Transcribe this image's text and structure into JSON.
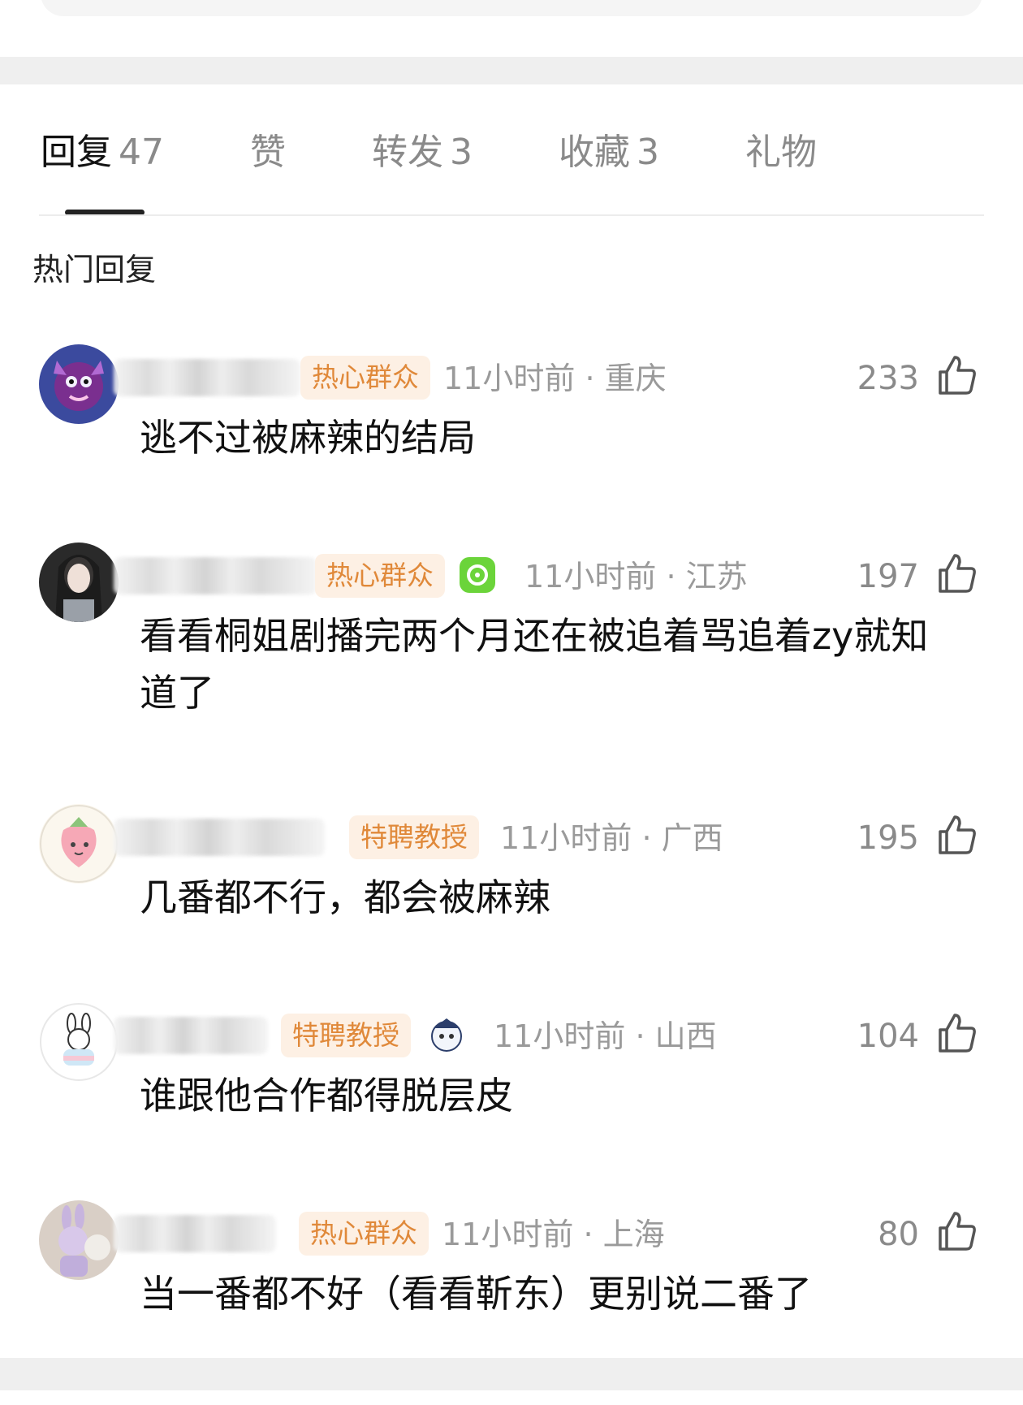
{
  "tabs": {
    "replies": {
      "label": "回复",
      "count": "47"
    },
    "likes": {
      "label": "赞"
    },
    "reposts": {
      "label": "转发",
      "count": "3"
    },
    "favorites": {
      "label": "收藏",
      "count": "3"
    },
    "gifts": {
      "label": "礼物"
    }
  },
  "section_title": "热门回复",
  "comments": [
    {
      "badge": "热心群众",
      "time": "11小时前",
      "location": "重庆",
      "likes": "233",
      "text": "逃不过被麻辣的结局"
    },
    {
      "badge": "热心群众",
      "time": "11小时前",
      "location": "江苏",
      "likes": "197",
      "text": "看看桐姐剧播完两个月还在被追着骂追着zy就知道了"
    },
    {
      "badge": "特聘教授",
      "time": "11小时前",
      "location": "广西",
      "likes": "195",
      "text": "几番都不行，都会被麻辣"
    },
    {
      "badge": "特聘教授",
      "time": "11小时前",
      "location": "山西",
      "likes": "104",
      "text": "谁跟他合作都得脱层皮"
    },
    {
      "badge": "热心群众",
      "time": "11小时前",
      "location": "上海",
      "likes": "80",
      "text": "当一番都不好（看看靳东）更别说二番了"
    }
  ],
  "meta_separator": " · ",
  "colors": {
    "badge_text": "#e0893a",
    "badge_bg": "#fdf0e4",
    "meta": "#9a9a9a",
    "tab_active": "#111111",
    "tab_inactive": "#8a8a8a"
  }
}
